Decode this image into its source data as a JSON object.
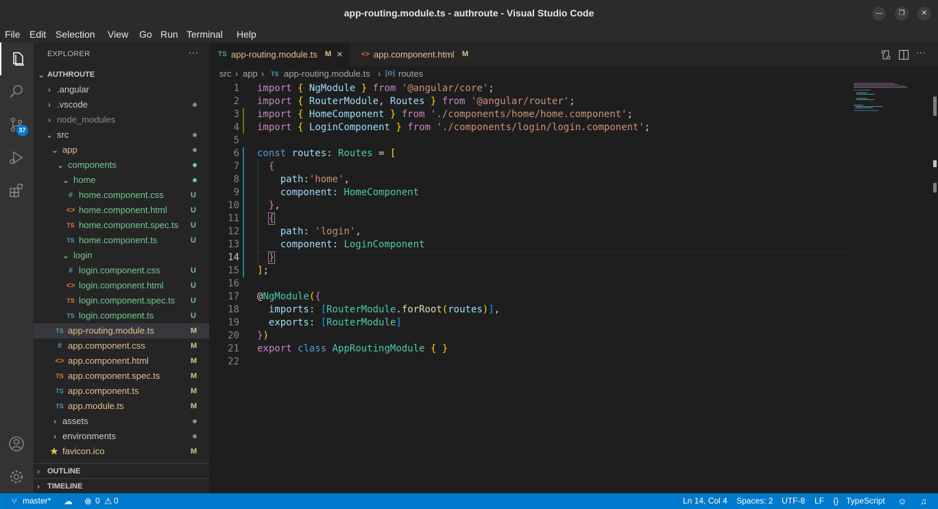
{
  "window": {
    "title": "app-routing.module.ts - authroute - Visual Studio Code"
  },
  "menu": [
    "File",
    "Edit",
    "Selection",
    "View",
    "Go",
    "Run",
    "Terminal",
    "Help"
  ],
  "activity": {
    "scm_badge": "37"
  },
  "explorer": {
    "header": "EXPLORER",
    "more": "···",
    "root": "AUTHROUTE",
    "items": [
      {
        "label": ".angular",
        "status": "",
        "icon": ""
      },
      {
        "label": ".vscode",
        "status": "",
        "icon": ""
      },
      {
        "label": "node_modules",
        "status": "",
        "icon": ""
      },
      {
        "label": "src",
        "status": "",
        "icon": ""
      },
      {
        "label": "app",
        "status": "",
        "icon": ""
      },
      {
        "label": "components",
        "status": "",
        "icon": ""
      },
      {
        "label": "home",
        "status": "",
        "icon": ""
      },
      {
        "label": "home.component.css",
        "status": "U",
        "icon": "#"
      },
      {
        "label": "home.component.html",
        "status": "U",
        "icon": "<>"
      },
      {
        "label": "home.component.spec.ts",
        "status": "U",
        "icon": "TS"
      },
      {
        "label": "home.component.ts",
        "status": "U",
        "icon": "TS"
      },
      {
        "label": "login",
        "status": "",
        "icon": ""
      },
      {
        "label": "login.component.css",
        "status": "U",
        "icon": "#"
      },
      {
        "label": "login.component.html",
        "status": "U",
        "icon": "<>"
      },
      {
        "label": "login.component.spec.ts",
        "status": "U",
        "icon": "TS"
      },
      {
        "label": "login.component.ts",
        "status": "U",
        "icon": "TS"
      },
      {
        "label": "app-routing.module.ts",
        "status": "M",
        "icon": "TS"
      },
      {
        "label": "app.component.css",
        "status": "M",
        "icon": "#"
      },
      {
        "label": "app.component.html",
        "status": "M",
        "icon": "<>"
      },
      {
        "label": "app.component.spec.ts",
        "status": "M",
        "icon": "TS"
      },
      {
        "label": "app.component.ts",
        "status": "M",
        "icon": "TS"
      },
      {
        "label": "app.module.ts",
        "status": "M",
        "icon": "TS"
      },
      {
        "label": "assets",
        "status": "",
        "icon": ""
      },
      {
        "label": "environments",
        "status": "",
        "icon": ""
      },
      {
        "label": "favicon.ico",
        "status": "M",
        "icon": "★"
      }
    ],
    "outline": "OUTLINE",
    "timeline": "TIMELINE"
  },
  "tabs": [
    {
      "icon": "TS",
      "label": "app-routing.module.ts",
      "mod": "M",
      "close": "×"
    },
    {
      "icon": "<>",
      "label": "app.component.html",
      "mod": "M"
    }
  ],
  "breadcrumb": {
    "p1": "src",
    "p2": "app",
    "file_icon": "TS",
    "file": "app-routing.module.ts",
    "symbol_icon": "[⊖]",
    "symbol": "routes",
    "sep": "›"
  },
  "line_numbers": [
    "1",
    "2",
    "3",
    "4",
    "5",
    "6",
    "7",
    "8",
    "9",
    "10",
    "11",
    "12",
    "13",
    "14",
    "15",
    "16",
    "17",
    "18",
    "19",
    "20",
    "21",
    "22"
  ],
  "code": {
    "l1": {
      "t1": "import",
      "t2": " { ",
      "t3": "NgModule",
      "t4": " } ",
      "t5": "from",
      "t6": " ",
      "t7": "'@angular/core'",
      "t8": ";"
    },
    "l2": {
      "t1": "import",
      "t2": " { ",
      "t3": "RouterModule",
      "t4": ", ",
      "t5": "Routes",
      "t6": " } ",
      "t7": "from",
      "t8": " ",
      "t9": "'@angular/router'",
      "t10": ";"
    },
    "l3": {
      "t1": "import",
      "t2": " { ",
      "t3": "HomeComponent",
      "t4": " } ",
      "t5": "from",
      "t6": " ",
      "t7": "'./components/home/home.component'",
      "t8": ";"
    },
    "l4": {
      "t1": "import",
      "t2": " { ",
      "t3": "LoginComponent",
      "t4": " } ",
      "t5": "from",
      "t6": " ",
      "t7": "'./components/login/login.component'",
      "t8": ";"
    },
    "l6": {
      "t1": "const",
      "t2": " ",
      "t3": "routes",
      "t4": ": ",
      "t5": "Routes",
      "t6": " = ",
      "t7": "["
    },
    "l7": {
      "t1": "  ",
      "t2": "{"
    },
    "l8": {
      "t1": "    ",
      "t2": "path",
      "t3": ":",
      "t4": "'home'",
      "t5": ","
    },
    "l9": {
      "t1": "    ",
      "t2": "component",
      "t3": ": ",
      "t4": "HomeComponent"
    },
    "l10": {
      "t1": "  ",
      "t2": "}",
      "t3": ","
    },
    "l11": {
      "t1": "  ",
      "t2": "{"
    },
    "l12": {
      "t1": "    ",
      "t2": "path",
      "t3": ": ",
      "t4": "'login'",
      "t5": ","
    },
    "l13": {
      "t1": "    ",
      "t2": "component",
      "t3": ": ",
      "t4": "LoginComponent"
    },
    "l14": {
      "t1": "  ",
      "t2": "}"
    },
    "l15": {
      "t1": "]",
      "t2": ";"
    },
    "l17": {
      "t1": "@",
      "t2": "NgModule",
      "t3": "(",
      "t4": "{"
    },
    "l18": {
      "t1": "  ",
      "t2": "imports",
      "t3": ": ",
      "t4": "[",
      "t5": "RouterModule",
      "t6": ".",
      "t7": "forRoot",
      "t8": "(",
      "t9": "routes",
      "t10": ")",
      "t11": "]",
      "t12": ","
    },
    "l19": {
      "t1": "  ",
      "t2": "exports",
      "t3": ": ",
      "t4": "[",
      "t5": "RouterModule",
      "t6": "]"
    },
    "l20": {
      "t1": "}",
      "t2": ")"
    },
    "l21": {
      "t1": "export",
      "t2": " ",
      "t3": "class",
      "t4": " ",
      "t5": "AppRoutingModule",
      "t6": " ",
      "t7": "{ }"
    }
  },
  "status": {
    "branch": "master*",
    "errors": "0",
    "warnings": "0",
    "position": "Ln 14, Col 4",
    "spaces": "Spaces: 2",
    "encoding": "UTF-8",
    "eol": "LF",
    "language": "TypeScript"
  },
  "colors": {
    "accent": "#007acc",
    "untracked": "#73c991",
    "modified": "#e2c08d",
    "ts_icon": "#519aba",
    "html_icon": "#e37933"
  }
}
